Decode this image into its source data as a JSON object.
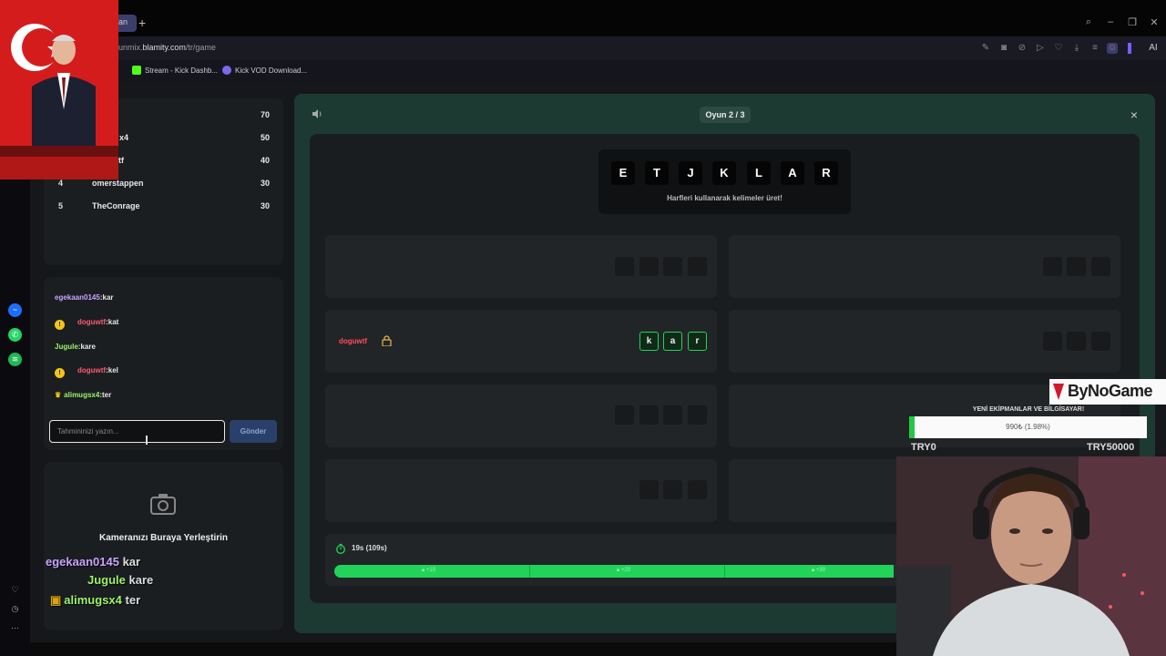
{
  "browser": {
    "tab_label": "lan",
    "url_prefix": "unmix.",
    "url_domain": "blamity.com",
    "url_path": "/tr/game",
    "ai_label": "AI",
    "bookmarks": [
      {
        "label": "Stream - Kick Dashb...",
        "icon_color": "#53fc18"
      },
      {
        "label": "Kick VOD Download...",
        "icon_color": "#7b68ee"
      }
    ]
  },
  "leaderboard": {
    "rows": [
      {
        "rank": "",
        "name": "",
        "score": "70"
      },
      {
        "rank": "",
        "name": "x4",
        "score": "50"
      },
      {
        "rank": "",
        "name": "tf",
        "score": "40"
      },
      {
        "rank": "4",
        "name": "omerstappen",
        "score": "30"
      },
      {
        "rank": "5",
        "name": "TheConrage",
        "score": "30"
      }
    ]
  },
  "chat": {
    "messages": [
      {
        "user": "egekaan0145",
        "text": "kar",
        "color": "#c9a4ff",
        "badge": "none"
      },
      {
        "user": "doguwtf",
        "text": "kat",
        "color": "#ff5a6e",
        "badge": "coin"
      },
      {
        "user": "Jugule",
        "text": "kare",
        "color": "#9cf46a",
        "badge": "none"
      },
      {
        "user": "doguwtf",
        "text": "kel",
        "color": "#ff5a6e",
        "badge": "coin"
      },
      {
        "user": "alimugsx4",
        "text": "ter",
        "color": "#9cf46a",
        "badge": "crown"
      }
    ],
    "separator": ":",
    "input_placeholder": "Tahmininizi yazın...",
    "send_label": "Gönder",
    "coin_glyph": "!"
  },
  "camera_panel": {
    "text": "Kameranızı Buraya Yerleştirin"
  },
  "stream_overlay_chat": [
    {
      "user": "egekaan0145",
      "text": "kar",
      "color": "#c9a4ff"
    },
    {
      "user": "Jugule",
      "text": "kare",
      "color": "#9cf46a"
    },
    {
      "user": "alimugsx4",
      "text": "ter",
      "color": "#9cf46a"
    }
  ],
  "game": {
    "round_label": "Oyun 2 / 3",
    "letters": [
      "E",
      "T",
      "J",
      "K",
      "L",
      "A",
      "R"
    ],
    "hint": "Harfleri kullanarak kelimeler üret!",
    "solved_word": {
      "solver": "doguwtf",
      "letters": [
        "k",
        "a",
        "r"
      ]
    },
    "timer_text": "19s (109s)",
    "progress_fraction": 0.72,
    "progress_labels": [
      "+10",
      "+20",
      "+30"
    ]
  },
  "donation": {
    "brand": "ByNoGame",
    "title": "YENİ EKİPMANLAR VE BİLGİSAYAR!",
    "progress_text": "990₺ (1.98%)",
    "progress_fraction": 0.0198,
    "min_label": "TRY0",
    "max_label": "TRY50000"
  }
}
